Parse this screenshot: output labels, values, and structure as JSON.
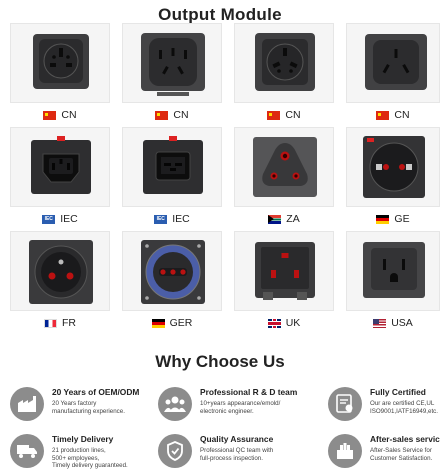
{
  "header": {
    "title": "Output Module"
  },
  "modules": [
    {
      "label": "CN",
      "flag": "cn",
      "socket": "universal"
    },
    {
      "label": "CN",
      "flag": "cn",
      "socket": "cn-5pin"
    },
    {
      "label": "CN",
      "flag": "cn",
      "socket": "universal"
    },
    {
      "label": "CN",
      "flag": "cn",
      "socket": "cn-3pin"
    },
    {
      "label": "IEC",
      "flag": "iec",
      "socket": "iec-c13"
    },
    {
      "label": "IEC",
      "flag": "iec",
      "socket": "iec-c19"
    },
    {
      "label": "ZA",
      "flag": "za",
      "socket": "za-triangle"
    },
    {
      "label": "GE",
      "flag": "de",
      "socket": "schuko"
    },
    {
      "label": "FR",
      "flag": "fr",
      "socket": "french"
    },
    {
      "label": "GER",
      "flag": "de",
      "socket": "schuko-round"
    },
    {
      "label": "UK",
      "flag": "uk",
      "socket": "uk"
    },
    {
      "label": "USA",
      "flag": "us",
      "socket": "us"
    }
  ],
  "why": {
    "title": "Why Choose Us",
    "features": [
      {
        "heading": "20 Years of OEM/ODM",
        "text": "20 Years factory\nmanufacturing experience.",
        "icon": "factory-icon"
      },
      {
        "heading": "Professional R & D team",
        "text": "10+years appearance/emold/\nelectronic engineer.",
        "icon": "team-icon"
      },
      {
        "heading": "Fully Certified",
        "text": "Our are certified CE,UL\nISO9001,IATF16949,etc.",
        "icon": "certificate-icon"
      },
      {
        "heading": "Timely Delivery",
        "text": "21 production lines,\n500+ employees,\nTimely delivery guaranteed.",
        "icon": "truck-icon"
      },
      {
        "heading": "Quality Assurance",
        "text": "Professional QC team with\nfull-process inspection.",
        "icon": "shield-icon"
      },
      {
        "heading": "After-sales service",
        "text": "After-Sales Service for\nCustomer Satisfaction.",
        "icon": "service-icon"
      }
    ]
  }
}
